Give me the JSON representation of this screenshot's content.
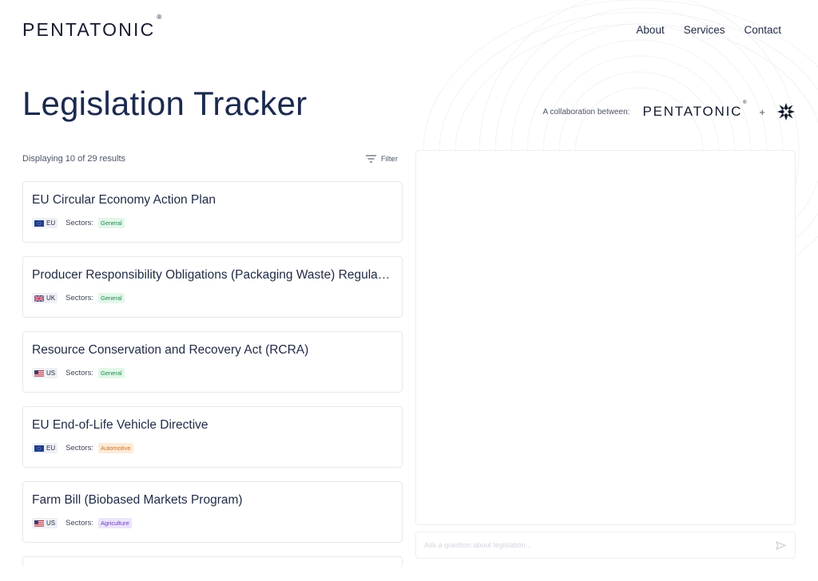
{
  "header": {
    "logo": "PENTATONIC",
    "logo_mark": "®",
    "nav": [
      {
        "label": "About"
      },
      {
        "label": "Services"
      },
      {
        "label": "Contact"
      }
    ]
  },
  "page": {
    "title": "Legislation Tracker",
    "collab_label": "A collaboration between:",
    "collab_logo": "PENTATONIC",
    "collab_logo_mark": "®",
    "collab_plus": "+"
  },
  "results": {
    "count_text": "Displaying 10 of 29 results",
    "filter_label": "Filter"
  },
  "sectors_label": "Sectors:",
  "items": [
    {
      "title": "EU Circular Economy Action Plan",
      "region": "EU",
      "sector": "General",
      "sector_color": "green"
    },
    {
      "title": "Producer Responsibility Obligations (Packaging Waste) Regulations",
      "region": "UK",
      "sector": "General",
      "sector_color": "green"
    },
    {
      "title": "Resource Conservation and Recovery Act (RCRA)",
      "region": "US",
      "sector": "General",
      "sector_color": "green"
    },
    {
      "title": "EU End-of-Life Vehicle Directive",
      "region": "EU",
      "sector": "Automotive",
      "sector_color": "orange"
    },
    {
      "title": "Farm Bill (Biobased Markets Program)",
      "region": "US",
      "sector": "Agriculture",
      "sector_color": "purple"
    }
  ],
  "chat": {
    "placeholder": "Ask a question about legislation..."
  },
  "colors": {
    "brand_navy": "#1b2a4e",
    "tag_green": "#1f8a4c",
    "tag_orange": "#d0711f",
    "tag_purple": "#6a3fc4"
  }
}
